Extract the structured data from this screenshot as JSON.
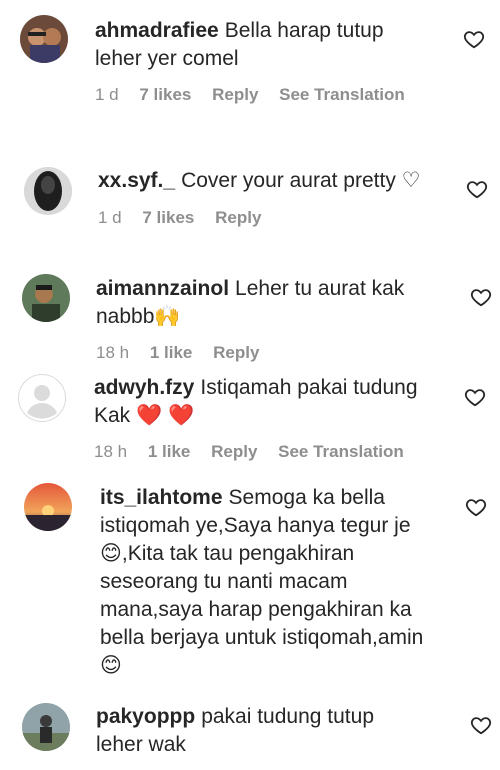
{
  "comments": [
    {
      "username": "ahmadrafiee",
      "text": "Bella harap tutup leher yer comel",
      "time": "1 d",
      "likes": "7 likes",
      "reply": "Reply",
      "translate": "See Translation"
    },
    {
      "username": "xx.syf._",
      "text": "Cover your aurat pretty ♡",
      "time": "1 d",
      "likes": "7 likes",
      "reply": "Reply"
    },
    {
      "username": "aimannzainol",
      "text": "Leher tu aurat kak nabbb🙌",
      "time": "18 h",
      "likes": "1 like",
      "reply": "Reply"
    },
    {
      "username": "adwyh.fzy",
      "text": "Istiqamah pakai tudung Kak ❤️ ❤️",
      "time": "18 h",
      "likes": "1 like",
      "reply": "Reply",
      "translate": "See Translation"
    },
    {
      "username": "its_ilahtome",
      "text": "Semoga ka bella istiqomah ye,Saya hanya tegur je 😊,Kita tak tau pengakhiran seseorang tu nanti macam mana,saya harap pengakhiran ka bella berjaya untuk istiqomah,amin 😊"
    },
    {
      "username": "pakyoppp",
      "text": "pakai tudung tutup leher wak"
    }
  ],
  "icons": {
    "like": "heart-outline-icon",
    "avatar_default": "default-avatar-icon"
  },
  "colors": {
    "text": "#262626",
    "meta": "#8e8e8e",
    "heart_red": "#ed4956"
  }
}
